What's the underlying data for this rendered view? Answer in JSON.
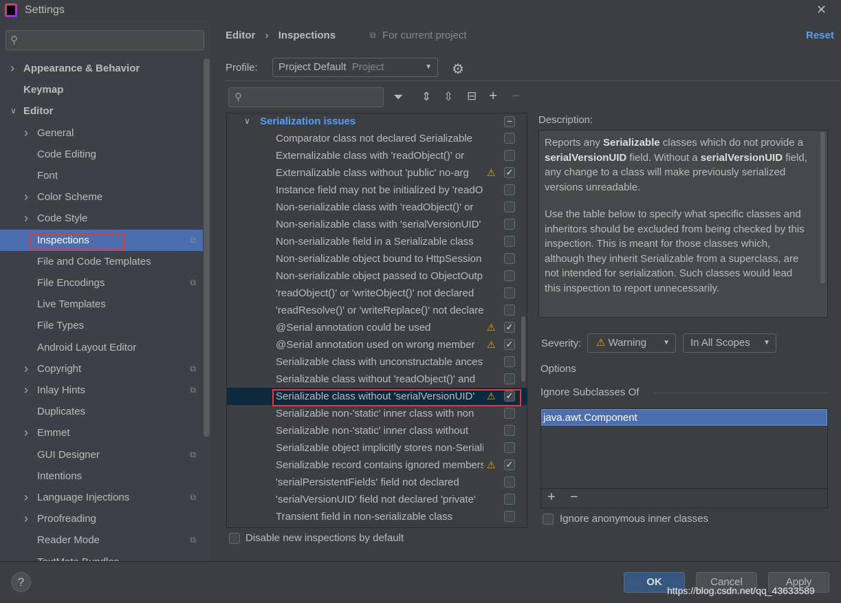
{
  "window": {
    "title": "Settings",
    "close": "✕"
  },
  "sidebar": {
    "search_placeholder": "",
    "items": [
      {
        "label": "Appearance & Behavior",
        "level": 0,
        "chevron": "right",
        "bold": true
      },
      {
        "label": "Keymap",
        "level": 0,
        "bold": true
      },
      {
        "label": "Editor",
        "level": 0,
        "chevron": "down",
        "bold": true
      },
      {
        "label": "General",
        "level": 1,
        "chevron": "right"
      },
      {
        "label": "Code Editing",
        "level": 1
      },
      {
        "label": "Font",
        "level": 1
      },
      {
        "label": "Color Scheme",
        "level": 1,
        "chevron": "right"
      },
      {
        "label": "Code Style",
        "level": 1,
        "chevron": "right"
      },
      {
        "label": "Inspections",
        "level": 1,
        "selected": true,
        "project_icon": true
      },
      {
        "label": "File and Code Templates",
        "level": 1
      },
      {
        "label": "File Encodings",
        "level": 1,
        "project_icon": true
      },
      {
        "label": "Live Templates",
        "level": 1
      },
      {
        "label": "File Types",
        "level": 1
      },
      {
        "label": "Android Layout Editor",
        "level": 1
      },
      {
        "label": "Copyright",
        "level": 1,
        "chevron": "right",
        "project_icon": true
      },
      {
        "label": "Inlay Hints",
        "level": 1,
        "chevron": "right",
        "project_icon": true
      },
      {
        "label": "Duplicates",
        "level": 1
      },
      {
        "label": "Emmet",
        "level": 1,
        "chevron": "right"
      },
      {
        "label": "GUI Designer",
        "level": 1,
        "project_icon": true
      },
      {
        "label": "Intentions",
        "level": 1
      },
      {
        "label": "Language Injections",
        "level": 1,
        "chevron": "right",
        "project_icon": true
      },
      {
        "label": "Proofreading",
        "level": 1,
        "chevron": "right"
      },
      {
        "label": "Reader Mode",
        "level": 1,
        "project_icon": true
      },
      {
        "label": "TextMate Bundles",
        "level": 1
      }
    ]
  },
  "header": {
    "breadcrumb": [
      "Editor",
      "Inspections"
    ],
    "scope": "For current project",
    "reset": "Reset"
  },
  "profile": {
    "label": "Profile:",
    "value": "Project Default",
    "value_type": "Project"
  },
  "tree": {
    "group": "Serialization issues",
    "rows": [
      {
        "label": "Comparator class not declared Serializable",
        "checked": false
      },
      {
        "label": "Externalizable class with 'readObject()' or",
        "checked": false
      },
      {
        "label": "Externalizable class without 'public' no-arg",
        "checked": true,
        "warning": true
      },
      {
        "label": "Instance field may not be initialized by 'readObject()'",
        "checked": false
      },
      {
        "label": "Non-serializable class with 'readObject()' or",
        "checked": false
      },
      {
        "label": "Non-serializable class with 'serialVersionUID'",
        "checked": false
      },
      {
        "label": "Non-serializable field in a Serializable class",
        "checked": false
      },
      {
        "label": "Non-serializable object bound to HttpSession",
        "checked": false
      },
      {
        "label": "Non-serializable object passed to ObjectOutputStream",
        "checked": false
      },
      {
        "label": "'readObject()' or 'writeObject()' not declared",
        "checked": false
      },
      {
        "label": "'readResolve()' or 'writeReplace()' not declared",
        "checked": false
      },
      {
        "label": "@Serial annotation could be used",
        "checked": true,
        "warning": true
      },
      {
        "label": "@Serial annotation used on wrong member",
        "checked": true,
        "warning": true
      },
      {
        "label": "Serializable class with unconstructable ancestor",
        "checked": false
      },
      {
        "label": "Serializable class without 'readObject()' and",
        "checked": false
      },
      {
        "label": "Serializable class without 'serialVersionUID'",
        "checked": true,
        "warning": true,
        "selected": true
      },
      {
        "label": "Serializable non-'static' inner class with non",
        "checked": false
      },
      {
        "label": "Serializable non-'static' inner class without",
        "checked": false
      },
      {
        "label": "Serializable object implicitly stores non-Serializable",
        "checked": false
      },
      {
        "label": "Serializable record contains ignored members",
        "checked": true,
        "warning": true
      },
      {
        "label": "'serialPersistentFields' field not declared",
        "checked": false
      },
      {
        "label": "'serialVersionUID' field not declared 'private'",
        "checked": false
      },
      {
        "label": "Transient field in non-serializable class",
        "checked": false
      }
    ]
  },
  "disable_new": {
    "label": "Disable new inspections by default",
    "checked": false
  },
  "description": {
    "title": "Description:",
    "p1": [
      [
        "Reports any ",
        false
      ],
      [
        "Serializable",
        true
      ],
      [
        " classes which do not provide a ",
        false
      ],
      [
        "serialVersionUID",
        true
      ],
      [
        " field. Without a ",
        false
      ],
      [
        "serialVersionUID",
        true
      ],
      [
        " field, any change to a class will make previously serialized versions unreadable.",
        false
      ]
    ],
    "p2": "Use the table below to specify what specific classes and inheritors should be excluded from being checked by this inspection. This is meant for those classes which, although they inherit Serializable from a superclass, are not intended for serialization. Such classes would lead this inspection to report unnecessarily."
  },
  "severity": {
    "label": "Severity:",
    "value": "Warning",
    "scope": "In All Scopes"
  },
  "options": {
    "title": "Options",
    "ignore_title": "Ignore Subclasses Of",
    "classes": [
      "java.awt.Component"
    ],
    "add": "+",
    "remove": "−",
    "anon_label": "Ignore anonymous inner classes",
    "anon_checked": false
  },
  "footer": {
    "help": "?",
    "ok": "OK",
    "cancel": "Cancel",
    "apply": "Apply",
    "watermark": "https://blog.csdn.net/qq_43633589"
  },
  "colors": {
    "accent": "#4b6eaf",
    "link": "#589df6",
    "highlight_box": "#e53935",
    "warning": "#d9a620"
  }
}
